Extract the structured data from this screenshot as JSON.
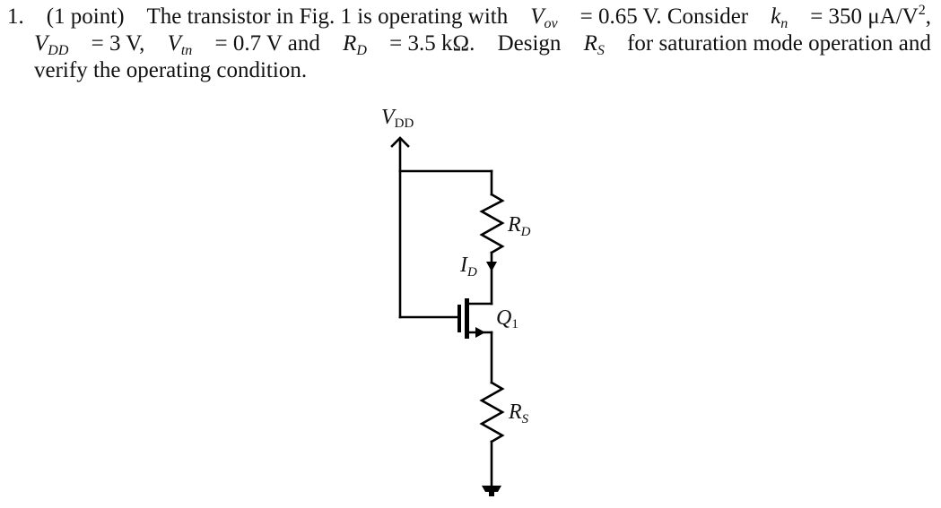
{
  "problem": {
    "number": "1.",
    "points": "(1 point)",
    "line1_text": "The transistor in Fig. 1 is operating with",
    "vov_symbol": "V",
    "vov_sub": "ov",
    "vov_value": "= 0.65 V. Consider",
    "kn_symbol": "k",
    "kn_sub": "n",
    "kn_value": "= 350 μA/V",
    "kn_exp": "2",
    "kn_trail": ",",
    "vdd_symbol": "V",
    "vdd_sub": "DD",
    "vdd_value": "= 3 V,",
    "vtn_symbol": "V",
    "vtn_sub": "tn",
    "vtn_value": "= 0.7 V and",
    "rd_symbol": "R",
    "rd_sub": "D",
    "rd_value": "= 3.5 kΩ.",
    "line2_text": "Design",
    "rs_symbol": "R",
    "rs_sub": "S",
    "line2_tail": "for saturation mode operation and",
    "line3_text": "verify the operating condition."
  },
  "figure": {
    "vdd_label_main": "V",
    "vdd_label_sub": "DD",
    "rd_label_main": "R",
    "rd_label_sub": "D",
    "id_label_main": "I",
    "id_label_sub": "D",
    "q1_label_main": "Q",
    "q1_label_sub": "1",
    "rs_label_main": "R",
    "rs_label_sub": "S"
  }
}
